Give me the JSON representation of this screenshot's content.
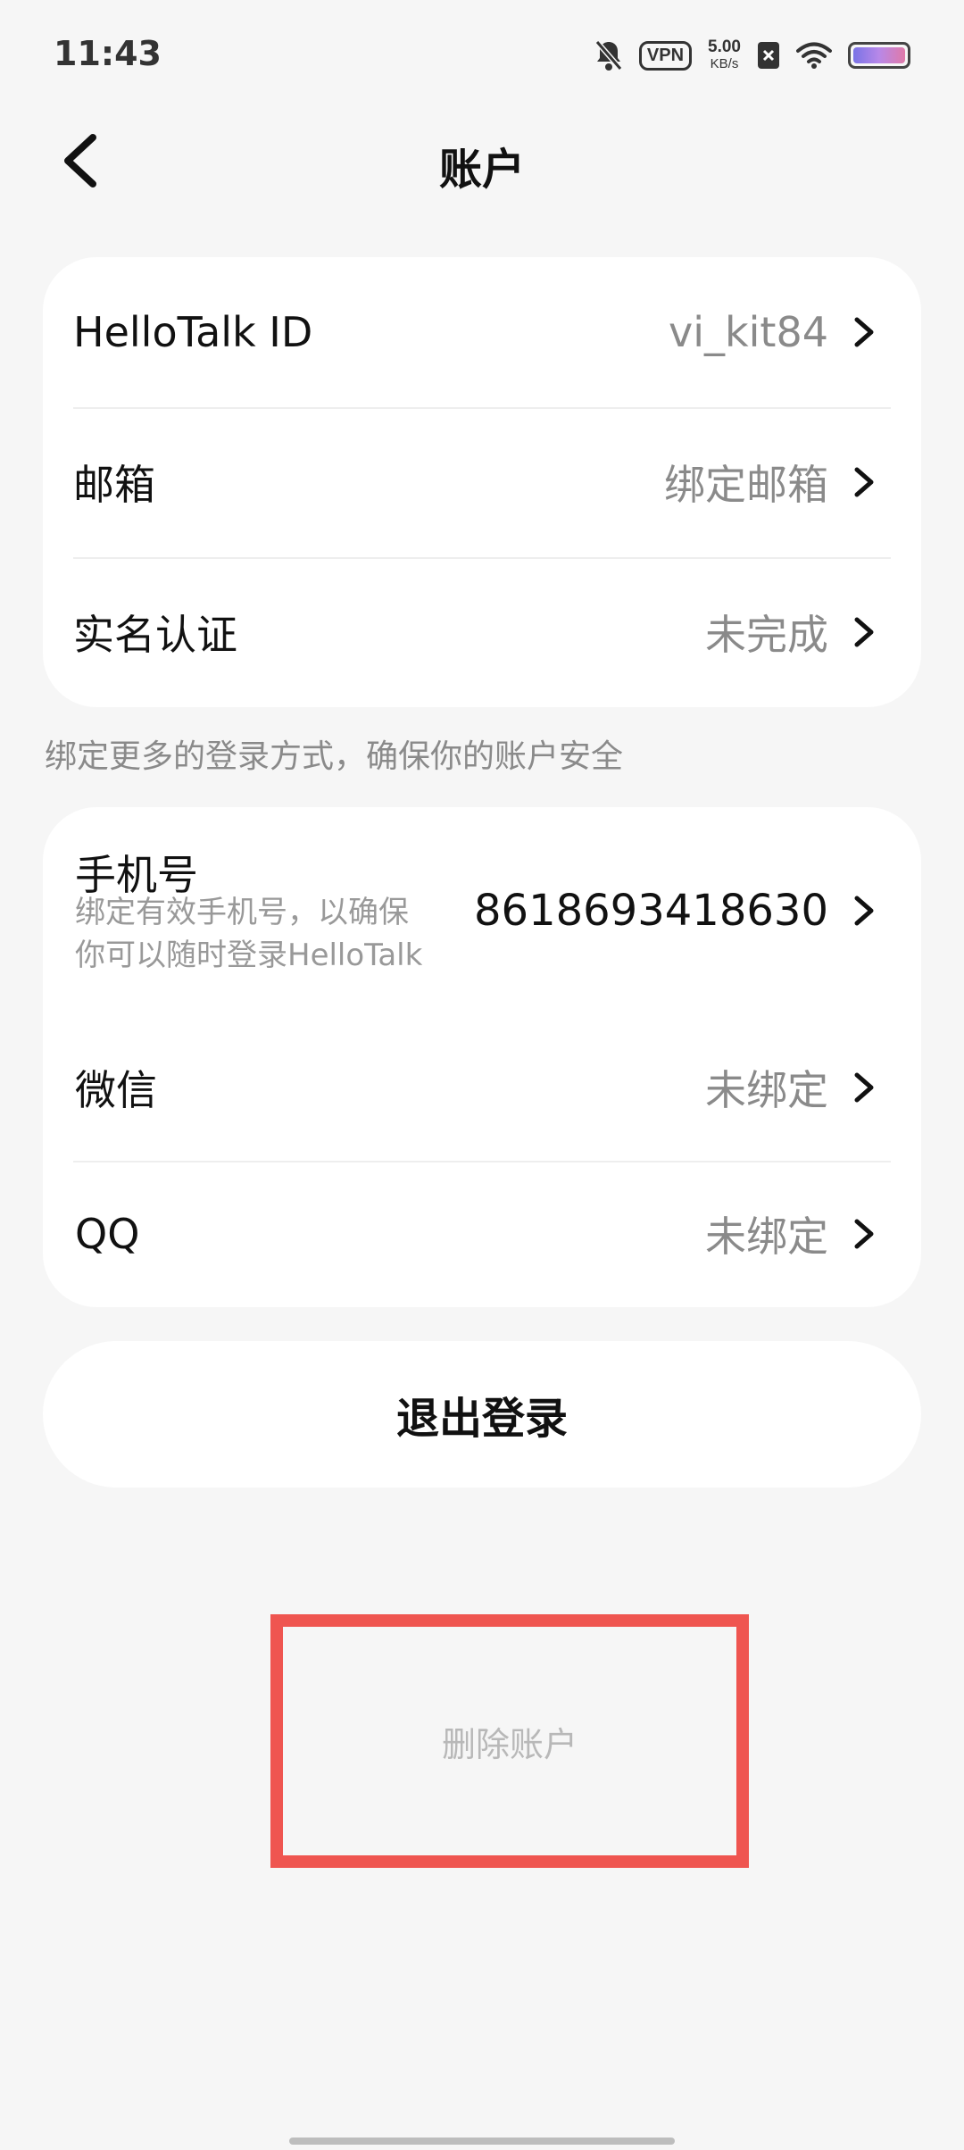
{
  "status_bar": {
    "time": "11:43",
    "vpn": "VPN",
    "speed_value": "5.00",
    "speed_unit": "KB/s"
  },
  "header": {
    "title": "账户"
  },
  "account_card": {
    "rows": [
      {
        "label": "HelloTalk ID",
        "value": "vi_kit84"
      },
      {
        "label": "邮箱",
        "value": "绑定邮箱"
      },
      {
        "label": "实名认证",
        "value": "未完成"
      }
    ]
  },
  "hint": "绑定更多的登录方式，确保你的账户安全",
  "login_card": {
    "phone": {
      "label": "手机号",
      "sub_line1": "绑定有效手机号，以确保",
      "sub_line2": "你可以随时登录HelloTalk",
      "value": "8618693418630"
    },
    "wechat": {
      "label": "微信",
      "value": "未绑定"
    },
    "qq": {
      "label": "QQ",
      "value": "未绑定"
    }
  },
  "logout_label": "退出登录",
  "delete_label": "删除账户",
  "colors": {
    "background": "#f6f6f6",
    "card": "#ffffff",
    "highlight_box": "#ef5550",
    "secondary_text": "#8a8a8a"
  }
}
